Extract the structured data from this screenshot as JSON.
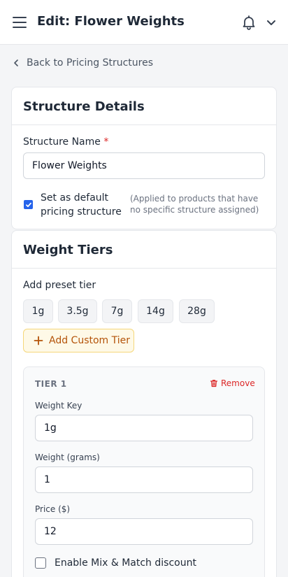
{
  "header": {
    "title": "Edit: Flower Weights"
  },
  "back_link": {
    "label": "Back to Pricing Structures"
  },
  "structure_details": {
    "heading": "Structure Details",
    "name_label": "Structure Name",
    "required_mark": "*",
    "name_value": "Flower Weights",
    "default_checkbox_label_line1": "Set as default",
    "default_checkbox_label_line2": "pricing structure",
    "default_checked": true,
    "default_hint": "(Applied to products that have no specific structure assigned)"
  },
  "weight_tiers": {
    "heading": "Weight Tiers",
    "preset_label": "Add preset tier",
    "presets": [
      "1g",
      "3.5g",
      "7g",
      "14g",
      "28g"
    ],
    "add_custom_label": "Add Custom Tier",
    "tiers": [
      {
        "title": "TIER 1",
        "remove_label": "Remove",
        "weight_key_label": "Weight Key",
        "weight_key_value": "1g",
        "weight_grams_label": "Weight (grams)",
        "weight_grams_value": "1",
        "price_label": "Price ($)",
        "price_value": "12",
        "mix_match_label": "Enable Mix & Match discount",
        "mix_match_checked": false
      }
    ]
  },
  "colors": {
    "accent_blue": "#2563eb",
    "danger_red": "#dc2626",
    "custom_tier_amber": "#b45309"
  }
}
